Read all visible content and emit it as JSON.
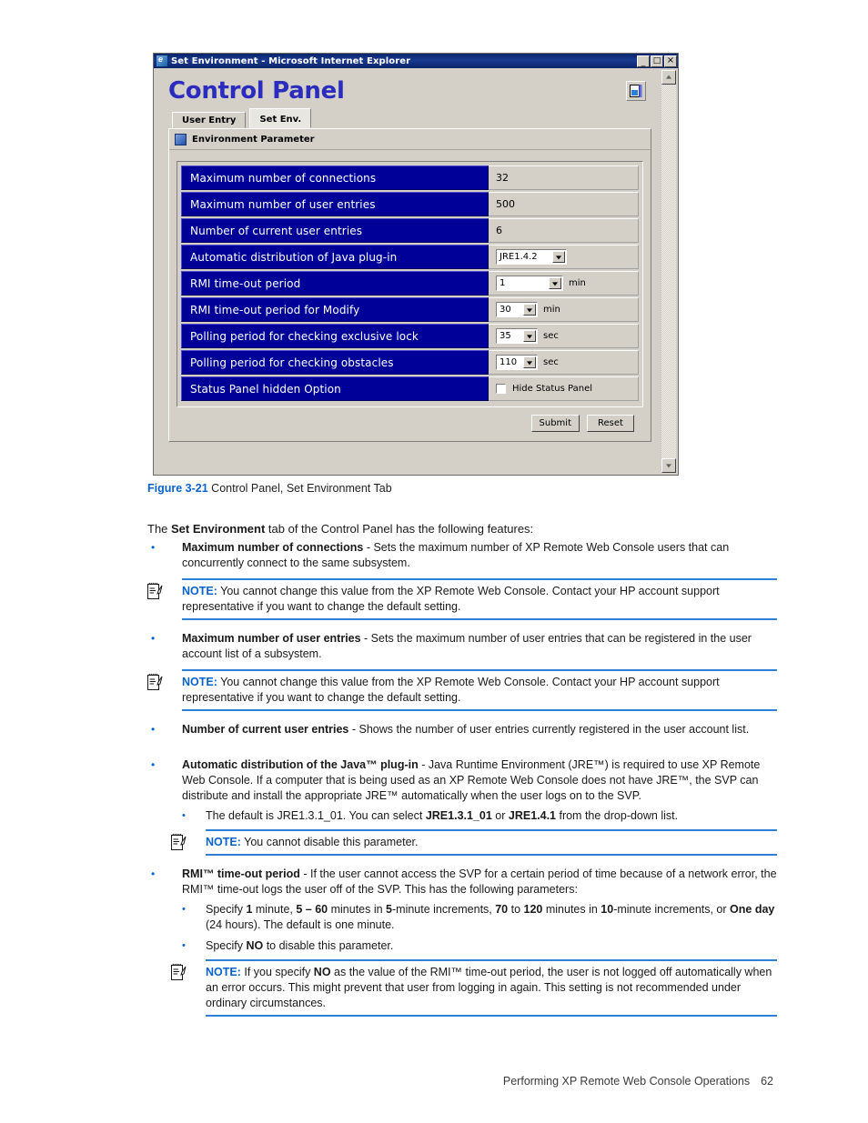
{
  "screenshot": {
    "window": {
      "title": "Set Environment - Microsoft Internet Explorer",
      "icon": "ie-icon",
      "minimize_label": "_",
      "maximize_label": "□",
      "close_label": "×"
    },
    "page_title": "Control Panel",
    "exit_button_name": "exit-icon",
    "tabs": [
      {
        "label": "User Entry",
        "active": false
      },
      {
        "label": "Set Env.",
        "active": true
      }
    ],
    "section_header": "Environment Parameter",
    "rows": [
      {
        "name": "Maximum number of connections",
        "kind": "text",
        "value": "32",
        "unit": ""
      },
      {
        "name": "Maximum number of user entries",
        "kind": "text",
        "value": "500",
        "unit": ""
      },
      {
        "name": "Number of current user entries",
        "kind": "text",
        "value": "6",
        "unit": ""
      },
      {
        "name": "Automatic distribution of Java plug-in",
        "kind": "select",
        "value": "JRE1.4.2",
        "unit": "",
        "width": "jre"
      },
      {
        "name": "RMI time-out period",
        "kind": "select",
        "value": "1",
        "unit": "min",
        "width": "wide"
      },
      {
        "name": "RMI time-out period for Modify",
        "kind": "select",
        "value": "30",
        "unit": "min",
        "width": "narrow"
      },
      {
        "name": "Polling period for checking exclusive lock",
        "kind": "select",
        "value": "35",
        "unit": "sec",
        "width": "narrow"
      },
      {
        "name": "Polling period for checking obstacles",
        "kind": "select",
        "value": "110",
        "unit": "sec",
        "width": "narrow"
      },
      {
        "name": "Status Panel hidden Option",
        "kind": "checkbox",
        "value": "",
        "checkbox_label": "Hide Status Panel",
        "checked": false
      }
    ],
    "buttons": {
      "submit": "Submit",
      "reset": "Reset"
    }
  },
  "figure_caption": {
    "number": "Figure 3-21",
    "text": " Control Panel, Set Environment Tab"
  },
  "intro": {
    "pre": "The ",
    "bold": "Set Environment",
    "post": " tab of the Control Panel has the following features:"
  },
  "body": {
    "b1": {
      "term": "Maximum number of connections",
      "text": " - Sets the maximum number of XP Remote Web Console users that can concurrently connect to the same subsystem."
    },
    "note1": {
      "label": "NOTE:",
      "text": " You cannot change this value from the XP Remote Web Console. Contact your HP account support representative if you want to change the default setting."
    },
    "b2": {
      "term": "Maximum number of user entries",
      "text": " - Sets the maximum number of user entries that can be registered in the user account list of a subsystem."
    },
    "note2": {
      "label": "NOTE:",
      "text": " You cannot change this value from the XP Remote Web Console. Contact your HP account support representative if you want to change the default setting."
    },
    "b3": {
      "term": "Number of current user entries",
      "text": " - Shows the number of user entries currently registered in the user account list."
    },
    "b4": {
      "term": "Automatic distribution of the Java™ plug-in",
      "text": " - Java Runtime Environment (JRE™) is required to use XP Remote Web Console. If a computer that is being used as an XP Remote Web Console does not have JRE™, the SVP can distribute and install the appropriate JRE™ automatically when the user logs on to the SVP."
    },
    "b4_sub1": {
      "pre": "The default is JRE1.3.1_01. You can select ",
      "bold1": "JRE1.3.1_01",
      "mid": " or ",
      "bold2": "JRE1.4.1",
      "post": " from the drop-down list."
    },
    "note3": {
      "label": "NOTE:",
      "text": " You cannot disable this parameter."
    },
    "b5": {
      "term": "RMI™ time-out period",
      "text": " - If the user cannot access the SVP for a certain period of time because of a network error, the RMI™ time-out logs the user off of the SVP. This has the following parameters:"
    },
    "b5_sub1": {
      "p1": "Specify ",
      "b1": "1",
      "p2": " minute, ",
      "b2": "5 – 60",
      "p3": " minutes in ",
      "b3": "5",
      "p4": "-minute increments, ",
      "b4": "70",
      "p5": " to ",
      "b5": "120",
      "p6": " minutes in ",
      "b6": "10",
      "p7": "-minute increments, or ",
      "b7": "One day",
      "p8": " (24 hours). The default is one minute."
    },
    "b5_sub2": {
      "pre": "Specify ",
      "bold": "NO",
      "post": " to disable this parameter."
    },
    "note4": {
      "label": "NOTE:",
      "pre": " If you specify ",
      "bold": "NO",
      "post": " as the value of the RMI™ time-out period, the user is not logged off automatically when an error occurs. This might prevent that user from logging in again. This setting is not recommended under ordinary circumstances."
    },
    "bullet_glyph": "•"
  },
  "footer": {
    "text": "Performing XP Remote Web Console Operations",
    "page": "62"
  },
  "colors": {
    "accent_blue": "#0a63c9",
    "rule_blue": "#2f7fd4",
    "form_label_blue": "#000099",
    "title_blue": "#2b2bbd",
    "titlebar": "#0a246a"
  }
}
